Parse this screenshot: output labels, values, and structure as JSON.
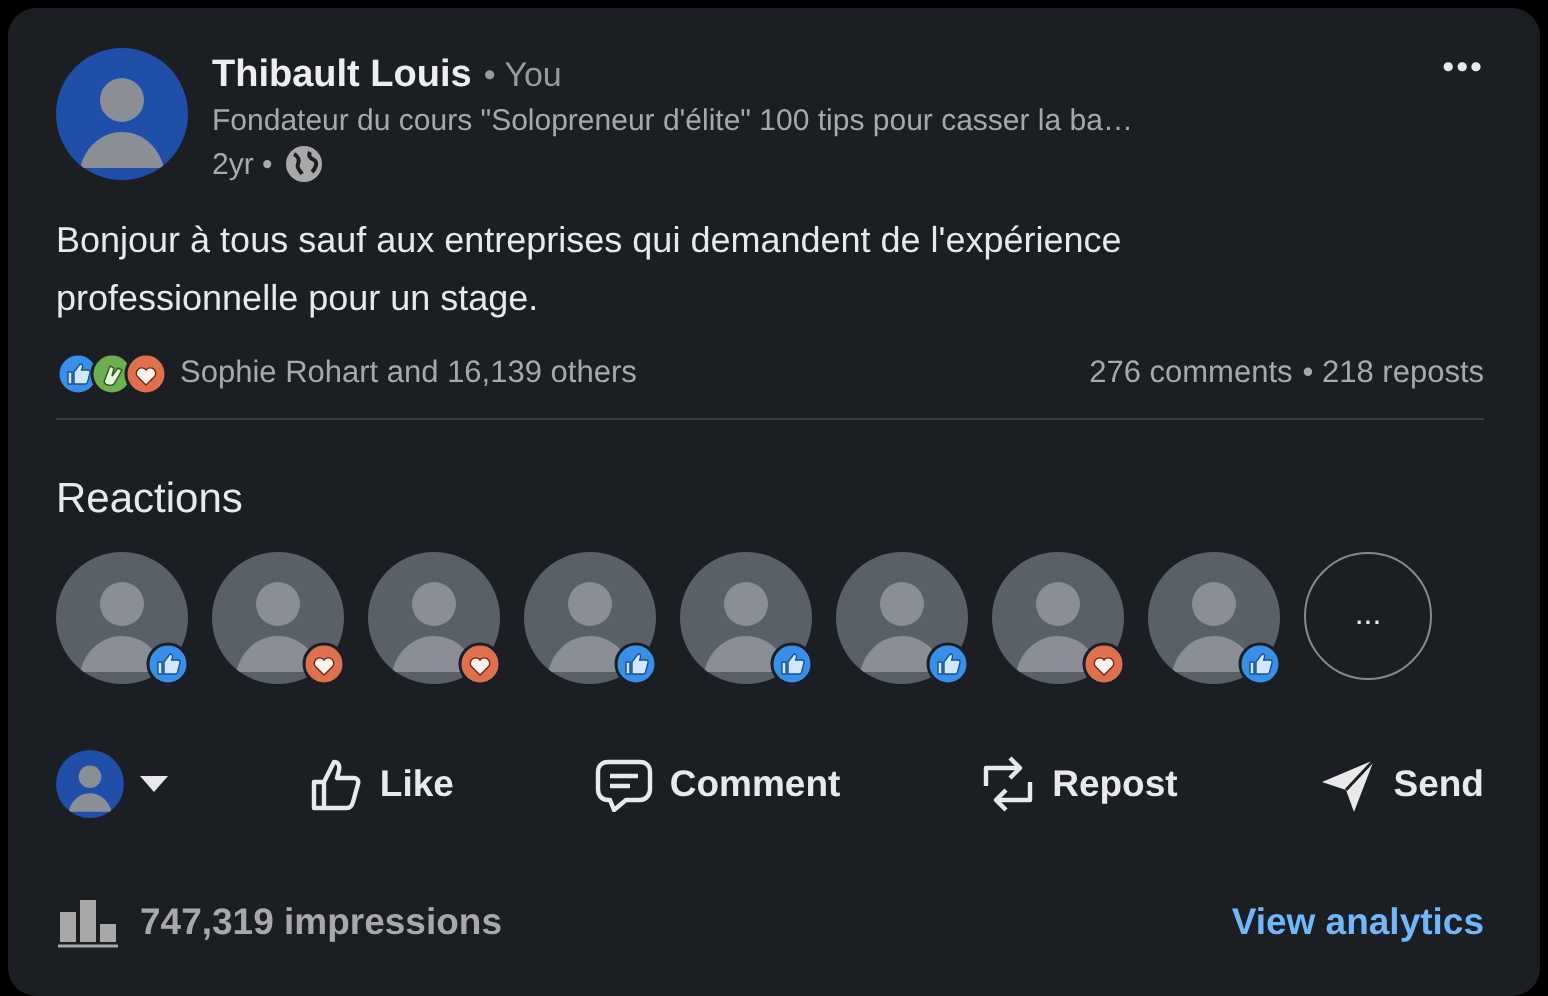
{
  "post": {
    "author": "Thibault Louis",
    "relation": "• You",
    "headline": "Fondateur du cours \"Solopreneur d'élite\" 100 tips pour casser la ba…",
    "age": "2yr •",
    "more": "•••",
    "text": "Bonjour à tous sauf aux entreprises qui demandent de l'expérience professionnelle pour un stage."
  },
  "summary": {
    "reactions": [
      {
        "kind": "like"
      },
      {
        "kind": "celebrate"
      },
      {
        "kind": "love"
      }
    ],
    "reactors": "Sophie Rohart and 16,139 others",
    "comments": "276 comments",
    "reposts": "• 218 reposts"
  },
  "reactions_section": {
    "title": "Reactions",
    "people": [
      {
        "kind": "like"
      },
      {
        "kind": "love"
      },
      {
        "kind": "love"
      },
      {
        "kind": "like"
      },
      {
        "kind": "like"
      },
      {
        "kind": "like"
      },
      {
        "kind": "love"
      },
      {
        "kind": "like"
      }
    ],
    "more": "..."
  },
  "actions": [
    {
      "kind": "like",
      "label": "Like"
    },
    {
      "kind": "comment",
      "label": "Comment"
    },
    {
      "kind": "repost",
      "label": "Repost"
    },
    {
      "kind": "send",
      "label": "Send"
    }
  ],
  "footer": {
    "impressions": "747,319 impressions",
    "link": "View analytics"
  }
}
